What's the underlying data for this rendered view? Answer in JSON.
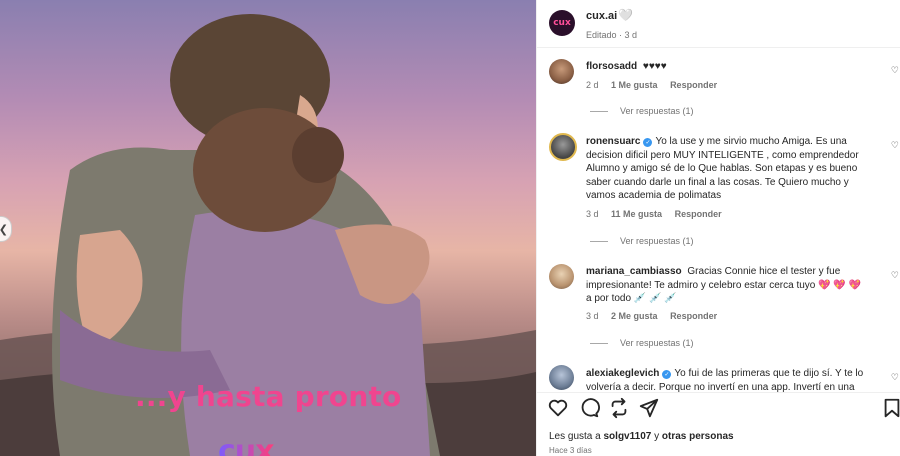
{
  "post": {
    "overlay_text": "...y hasta pronto",
    "overlay_logo": "cux",
    "author": "cux.ai",
    "author_avatar_text": "cux",
    "author_heart": "🤍",
    "edited": "Editado · 3 d"
  },
  "comments": [
    {
      "user": "florsosadd",
      "verified": false,
      "text": "♥♥♥♥",
      "age": "2 d",
      "likes": "1 Me gusta",
      "reply": "Responder",
      "view_replies": "Ver respuestas (1)"
    },
    {
      "user": "ronensuarc",
      "verified": true,
      "text": "Yo la use y me sirvio mucho Amiga. Es una decision dificil pero MUY INTELIGENTE , como emprendedor Alumno y amigo sé de lo Que hablas. Son etapas y es bueno saber cuando darle un final a las cosas. Te Quiero mucho y vamos academia de polimatas",
      "age": "3 d",
      "likes": "11 Me gusta",
      "reply": "Responder",
      "view_replies": "Ver respuestas (1)"
    },
    {
      "user": "mariana_cambiasso",
      "verified": false,
      "text": "Gracias Connie hice el tester y fue impresionante! Te admiro y celebro estar cerca tuyo 💖 💖 💖 a por todo 💉 💉 💉",
      "age": "3 d",
      "likes": "2 Me gusta",
      "reply": "Responder",
      "view_replies": "Ver respuestas (1)"
    },
    {
      "user": "alexiakeglevich",
      "verified": true,
      "text": "Yo fui de las primeras que te dijo sí. Y te lo volvería a decir. Porque no invertí en una app. Invertí en una"
    }
  ],
  "footer": {
    "likes_prefix": "Les gusta a",
    "likes_user": "solgv1107",
    "likes_and": "y",
    "likes_others": "otras personas",
    "date": "Hace 3 días"
  },
  "icons": {
    "like": "heart-icon",
    "comment": "comment-icon",
    "share": "repost-icon",
    "send": "send-icon",
    "save": "bookmark-icon"
  },
  "colors": {
    "overlay_pink": "#f0458f",
    "verified_blue": "#3897f0",
    "meta_gray": "#737373"
  }
}
